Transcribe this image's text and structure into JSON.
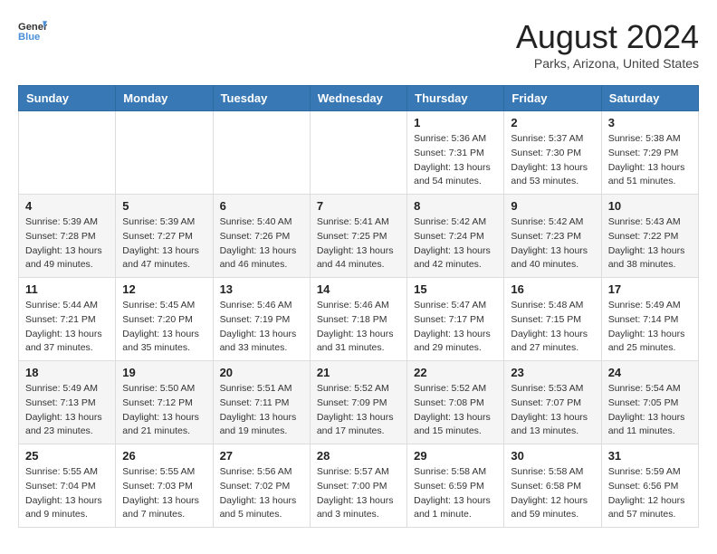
{
  "header": {
    "logo_line1": "General",
    "logo_line2": "Blue",
    "main_title": "August 2024",
    "subtitle": "Parks, Arizona, United States"
  },
  "calendar": {
    "headers": [
      "Sunday",
      "Monday",
      "Tuesday",
      "Wednesday",
      "Thursday",
      "Friday",
      "Saturday"
    ],
    "weeks": [
      [
        {
          "day": "",
          "info": ""
        },
        {
          "day": "",
          "info": ""
        },
        {
          "day": "",
          "info": ""
        },
        {
          "day": "",
          "info": ""
        },
        {
          "day": "1",
          "info": "Sunrise: 5:36 AM\nSunset: 7:31 PM\nDaylight: 13 hours\nand 54 minutes."
        },
        {
          "day": "2",
          "info": "Sunrise: 5:37 AM\nSunset: 7:30 PM\nDaylight: 13 hours\nand 53 minutes."
        },
        {
          "day": "3",
          "info": "Sunrise: 5:38 AM\nSunset: 7:29 PM\nDaylight: 13 hours\nand 51 minutes."
        }
      ],
      [
        {
          "day": "4",
          "info": "Sunrise: 5:39 AM\nSunset: 7:28 PM\nDaylight: 13 hours\nand 49 minutes."
        },
        {
          "day": "5",
          "info": "Sunrise: 5:39 AM\nSunset: 7:27 PM\nDaylight: 13 hours\nand 47 minutes."
        },
        {
          "day": "6",
          "info": "Sunrise: 5:40 AM\nSunset: 7:26 PM\nDaylight: 13 hours\nand 46 minutes."
        },
        {
          "day": "7",
          "info": "Sunrise: 5:41 AM\nSunset: 7:25 PM\nDaylight: 13 hours\nand 44 minutes."
        },
        {
          "day": "8",
          "info": "Sunrise: 5:42 AM\nSunset: 7:24 PM\nDaylight: 13 hours\nand 42 minutes."
        },
        {
          "day": "9",
          "info": "Sunrise: 5:42 AM\nSunset: 7:23 PM\nDaylight: 13 hours\nand 40 minutes."
        },
        {
          "day": "10",
          "info": "Sunrise: 5:43 AM\nSunset: 7:22 PM\nDaylight: 13 hours\nand 38 minutes."
        }
      ],
      [
        {
          "day": "11",
          "info": "Sunrise: 5:44 AM\nSunset: 7:21 PM\nDaylight: 13 hours\nand 37 minutes."
        },
        {
          "day": "12",
          "info": "Sunrise: 5:45 AM\nSunset: 7:20 PM\nDaylight: 13 hours\nand 35 minutes."
        },
        {
          "day": "13",
          "info": "Sunrise: 5:46 AM\nSunset: 7:19 PM\nDaylight: 13 hours\nand 33 minutes."
        },
        {
          "day": "14",
          "info": "Sunrise: 5:46 AM\nSunset: 7:18 PM\nDaylight: 13 hours\nand 31 minutes."
        },
        {
          "day": "15",
          "info": "Sunrise: 5:47 AM\nSunset: 7:17 PM\nDaylight: 13 hours\nand 29 minutes."
        },
        {
          "day": "16",
          "info": "Sunrise: 5:48 AM\nSunset: 7:15 PM\nDaylight: 13 hours\nand 27 minutes."
        },
        {
          "day": "17",
          "info": "Sunrise: 5:49 AM\nSunset: 7:14 PM\nDaylight: 13 hours\nand 25 minutes."
        }
      ],
      [
        {
          "day": "18",
          "info": "Sunrise: 5:49 AM\nSunset: 7:13 PM\nDaylight: 13 hours\nand 23 minutes."
        },
        {
          "day": "19",
          "info": "Sunrise: 5:50 AM\nSunset: 7:12 PM\nDaylight: 13 hours\nand 21 minutes."
        },
        {
          "day": "20",
          "info": "Sunrise: 5:51 AM\nSunset: 7:11 PM\nDaylight: 13 hours\nand 19 minutes."
        },
        {
          "day": "21",
          "info": "Sunrise: 5:52 AM\nSunset: 7:09 PM\nDaylight: 13 hours\nand 17 minutes."
        },
        {
          "day": "22",
          "info": "Sunrise: 5:52 AM\nSunset: 7:08 PM\nDaylight: 13 hours\nand 15 minutes."
        },
        {
          "day": "23",
          "info": "Sunrise: 5:53 AM\nSunset: 7:07 PM\nDaylight: 13 hours\nand 13 minutes."
        },
        {
          "day": "24",
          "info": "Sunrise: 5:54 AM\nSunset: 7:05 PM\nDaylight: 13 hours\nand 11 minutes."
        }
      ],
      [
        {
          "day": "25",
          "info": "Sunrise: 5:55 AM\nSunset: 7:04 PM\nDaylight: 13 hours\nand 9 minutes."
        },
        {
          "day": "26",
          "info": "Sunrise: 5:55 AM\nSunset: 7:03 PM\nDaylight: 13 hours\nand 7 minutes."
        },
        {
          "day": "27",
          "info": "Sunrise: 5:56 AM\nSunset: 7:02 PM\nDaylight: 13 hours\nand 5 minutes."
        },
        {
          "day": "28",
          "info": "Sunrise: 5:57 AM\nSunset: 7:00 PM\nDaylight: 13 hours\nand 3 minutes."
        },
        {
          "day": "29",
          "info": "Sunrise: 5:58 AM\nSunset: 6:59 PM\nDaylight: 13 hours\nand 1 minute."
        },
        {
          "day": "30",
          "info": "Sunrise: 5:58 AM\nSunset: 6:58 PM\nDaylight: 12 hours\nand 59 minutes."
        },
        {
          "day": "31",
          "info": "Sunrise: 5:59 AM\nSunset: 6:56 PM\nDaylight: 12 hours\nand 57 minutes."
        }
      ]
    ]
  }
}
